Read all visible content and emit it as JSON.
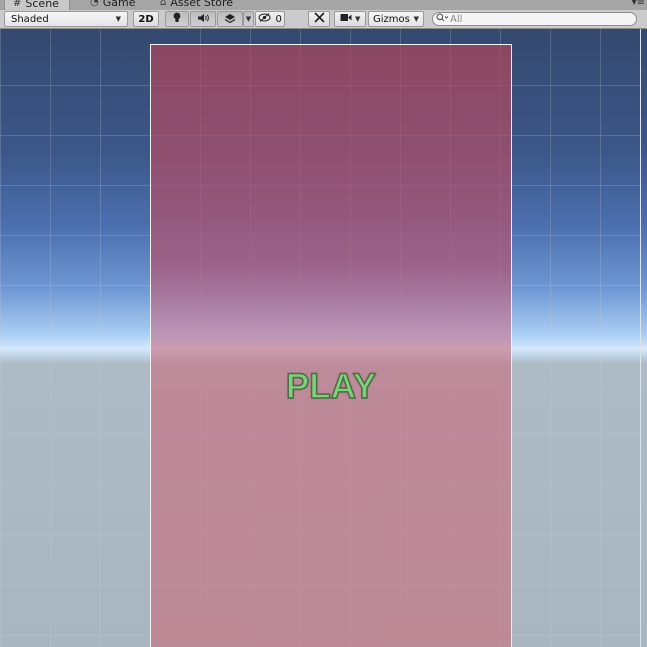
{
  "tabs": [
    {
      "label": "Scene",
      "icon": "hash-icon",
      "active": true
    },
    {
      "label": "Game",
      "icon": "pacman-icon",
      "active": false
    },
    {
      "label": "Asset Store",
      "icon": "store-icon",
      "active": false
    }
  ],
  "toolbar": {
    "shading_mode": "Shaded",
    "mode_2d": "2D",
    "hidden_count": "0",
    "gizmos": "Gizmos",
    "search_placeholder": "All"
  },
  "scene": {
    "button_text": "PLAY"
  },
  "colors": {
    "sky_top": "#34496f",
    "horizon": "#d6e9fb",
    "ground": "#aab6bf",
    "canvas_tint": "#b8526c",
    "play_text": "#7ed07a"
  }
}
